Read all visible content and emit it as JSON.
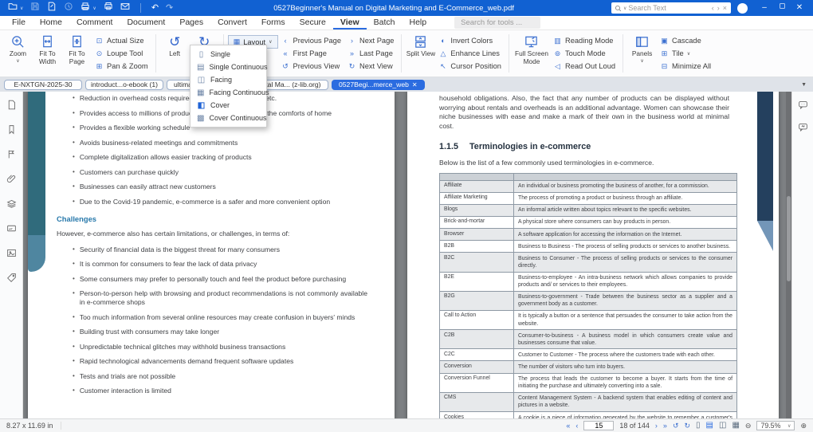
{
  "titlebar": {
    "title": "0527Beginner's Manual on Digital Marketing and E-Commerce_web.pdf",
    "search_placeholder": "Search Text",
    "quick_access_icons": [
      "open",
      "save",
      "save-as",
      "ocr",
      "print",
      "quick-print",
      "email",
      "undo",
      "redo"
    ]
  },
  "menubar": {
    "items": [
      {
        "label": "File"
      },
      {
        "label": "Home"
      },
      {
        "label": "Comment"
      },
      {
        "label": "Document"
      },
      {
        "label": "Pages"
      },
      {
        "label": "Convert"
      },
      {
        "label": "Forms"
      },
      {
        "label": "Secure"
      },
      {
        "label": "View",
        "active": true
      },
      {
        "label": "Batch"
      },
      {
        "label": "Help"
      }
    ],
    "tools_search_placeholder": "Search for tools ..."
  },
  "ribbon": {
    "zoom_label": "Zoom",
    "fit_width_label": "Fit To Width",
    "fit_page_label": "Fit To Page",
    "zoom_stack": [
      {
        "icon": "⊡",
        "label": "Actual Size"
      },
      {
        "icon": "⊙",
        "label": "Loupe Tool"
      },
      {
        "icon": "⊞",
        "label": "Pan & Zoom"
      }
    ],
    "rotate_left_label": "Left",
    "rotate_right_label": "Right",
    "layout_label": "Layout",
    "nav_col1": [
      {
        "icon": "‹",
        "label": "Previous Page"
      },
      {
        "icon": "«",
        "label": "First Page"
      },
      {
        "icon": "↺",
        "label": "Previous View"
      }
    ],
    "nav_col2": [
      {
        "icon": "›",
        "label": "Next Page"
      },
      {
        "icon": "»",
        "label": "Last Page"
      },
      {
        "icon": "↻",
        "label": "Next View"
      }
    ],
    "split_view_label": "Split View",
    "view_stack": [
      {
        "icon": "◐",
        "label": "Invert Colors"
      },
      {
        "icon": "△",
        "label": "Enhance Lines"
      },
      {
        "icon": "↖",
        "label": "Cursor Position"
      }
    ],
    "full_screen_label": "Full Screen Mode",
    "mode_stack": [
      {
        "icon": "▥",
        "label": "Reading Mode"
      },
      {
        "icon": "⊚",
        "label": "Touch Mode"
      },
      {
        "icon": "◁",
        "label": "Read Out Loud"
      }
    ],
    "panels_label": "Panels",
    "window_stack": [
      {
        "icon": "▣",
        "label": "Cascade"
      },
      {
        "icon": "⊞",
        "label": "Tile",
        "caret": true
      },
      {
        "icon": "⊟",
        "label": "Minimize All"
      }
    ]
  },
  "layout_menu": {
    "items": [
      {
        "icon": "▯",
        "label": "Single"
      },
      {
        "icon": "▤",
        "label": "Single Continuous"
      },
      {
        "icon": "◫",
        "label": "Facing"
      },
      {
        "icon": "▦",
        "label": "Facing Continuous"
      },
      {
        "icon": "◧",
        "label": "Cover",
        "active": true
      },
      {
        "icon": "▩",
        "label": "Cover Continuous"
      }
    ]
  },
  "tabs": {
    "items": [
      {
        "label": "E-NXTGN-2025-30"
      },
      {
        "label": "introduct...o-ebook (1)"
      },
      {
        "label": "ultimat..."
      },
      {
        "label": "Digital Ma... (z-lib.org)"
      },
      {
        "label": "0527Begi...merce_web",
        "active": true,
        "closable": true
      }
    ]
  },
  "sidebar_left_icons": [
    "page-thumbnails",
    "bookmarks",
    "annotations",
    "attachments",
    "layers",
    "signature",
    "images",
    "tags"
  ],
  "sidebar_right_icons": [
    "comments",
    "feedback"
  ],
  "page_left": {
    "bullets_1": [
      "Reduction in overhead costs required for office space, travel, etc.",
      "Provides access to millions of products across the globe from the comforts of home",
      "Provides a flexible working schedule",
      "Avoids business-related meetings and commitments",
      "Complete digitalization allows easier tracking of products",
      "Customers can purchase quickly",
      "Businesses can easily attract new customers",
      "Due to the Covid-19 pandemic, e-commerce is a safer and more convenient option"
    ],
    "heading": "Challenges",
    "intro": "However, e-commerce also has certain limitations, or challenges, in terms of:",
    "bullets_2": [
      "Security of financial data is the biggest threat for many consumers",
      "It is common for consumers to fear the lack of data privacy",
      "Some consumers may prefer to personally touch and feel the product before purchasing",
      "Person-to-person help with browsing and product recommendations is not commonly available in e-commerce shops",
      "Too much information from several online resources may create confusion in buyers' minds",
      "Building trust with consumers may take longer",
      "Unpredictable technical glitches may withhold business transactions",
      "Rapid technological advancements demand frequent software updates",
      "Tests and trials are not possible",
      "Customer interaction is limited"
    ]
  },
  "page_right": {
    "paragraph": "household obligations. Also, the fact that any number of products can be displayed without worrying about rentals and overheads is an additional advantage. Women can showcase their niche businesses with ease and make a mark of their own in the business world at minimal cost.",
    "heading_num": "1.1.5",
    "heading_text": "Terminologies in e-commerce",
    "table_intro": "Below is the list of a few commonly used terminologies in e-commerce.",
    "table_rows": [
      {
        "term": "Affiliate",
        "def": "An individual or business promoting the business of another, for a commission."
      },
      {
        "term": "Affiliate Marketing",
        "def": "The process of promoting a product or business through an affiliate."
      },
      {
        "term": "Blogs",
        "def": "An informal article written about topics relevant to the specific websites."
      },
      {
        "term": "Brick-and-mortar",
        "def": "A physical store where consumers can buy products in person."
      },
      {
        "term": "Browser",
        "def": "A software application for accessing the information on the Internet."
      },
      {
        "term": "B2B",
        "def": "Business to Business - The process of selling products or services to another business."
      },
      {
        "term": "B2C",
        "def": "Business to Consumer - The process of selling products or services to the consumer directly."
      },
      {
        "term": "B2E",
        "def": "Business-to-employee - An intra-business network which allows companies to provide products and/ or services to their employees."
      },
      {
        "term": "B2G",
        "def": "Business-to-government - Trade between the business sector as a supplier and a government body as a customer."
      },
      {
        "term": "Call to Action",
        "def": "It is typically a button or a sentence that persuades the consumer to take action from the website."
      },
      {
        "term": "C2B",
        "def": "Consumer-to-business - A business model in which consumers create value and businesses consume that value."
      },
      {
        "term": "C2C",
        "def": "Customer to Customer - The process where the customers trade with each other."
      },
      {
        "term": "Conversion",
        "def": "The number of visitors who turn into buyers."
      },
      {
        "term": "Conversion Funnel",
        "def": "The process that leads the customer to become a buyer. It starts from the time of initiating the purchase and ultimately converting into a sale."
      },
      {
        "term": "CMS",
        "def": "Content Management System - A backend system that enables editing of content and pictures in a website."
      },
      {
        "term": "Cookies",
        "def": "A cookie is a piece of information generated by the website to remember a customer's preferences when using a particular website."
      }
    ]
  },
  "statusbar": {
    "page_size": "8.27 x 11.69 in",
    "page_input": "15",
    "page_count": "18 of 144",
    "zoom_value": "79.5%"
  },
  "colors": {
    "titlebar": "#1161d2",
    "accent": "#2b6ce0",
    "heading_teal": "#2879ab"
  }
}
